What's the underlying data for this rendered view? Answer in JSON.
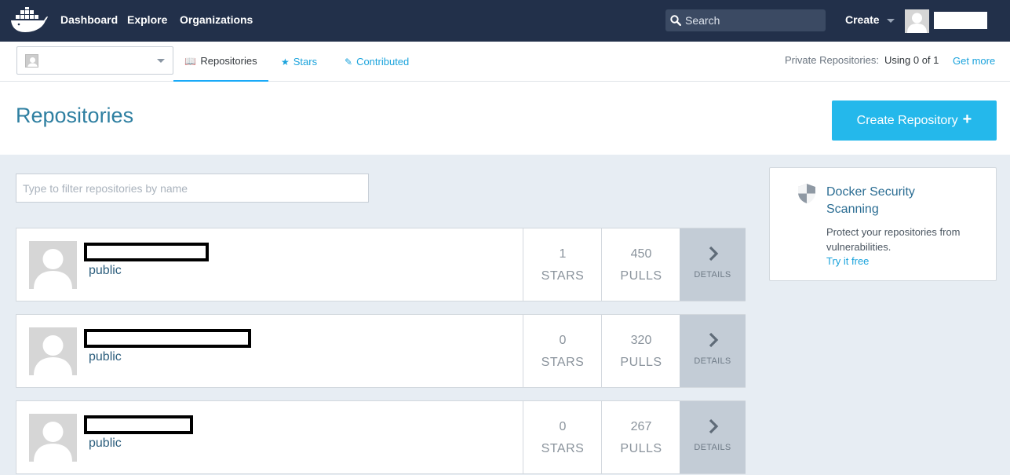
{
  "topnav": {
    "links": [
      "Dashboard",
      "Explore",
      "Organizations"
    ],
    "search_placeholder": "Search",
    "create_label": "Create",
    "icons": {
      "logo": "docker-whale-logo",
      "search": "search-icon",
      "avatar": "user-avatar"
    }
  },
  "subnav": {
    "tabs": [
      {
        "label": "Repositories",
        "icon": "book-icon",
        "active": true
      },
      {
        "label": "Stars",
        "icon": "star-icon",
        "active": false
      },
      {
        "label": "Contributed",
        "icon": "edit-icon",
        "active": false
      }
    ],
    "private_label": "Private Repositories:",
    "private_usage": "Using 0 of 1",
    "get_more": "Get more"
  },
  "header": {
    "title": "Repositories",
    "create_button": "Create Repository"
  },
  "filter": {
    "placeholder": "Type to filter repositories by name"
  },
  "repos": [
    {
      "visibility": "public",
      "stars": "1",
      "stars_label": "STARS",
      "pulls": "450",
      "pulls_label": "PULLS",
      "details": "DETAILS"
    },
    {
      "visibility": "public",
      "stars": "0",
      "stars_label": "STARS",
      "pulls": "320",
      "pulls_label": "PULLS",
      "details": "DETAILS"
    },
    {
      "visibility": "public",
      "stars": "0",
      "stars_label": "STARS",
      "pulls": "267",
      "pulls_label": "PULLS",
      "details": "DETAILS"
    }
  ],
  "security": {
    "title": "Docker Security Scanning",
    "description": "Protect your repositories from vulnerabilities.",
    "link": "Try it free",
    "icon": "shield-icon"
  },
  "colors": {
    "navbar": "#22304a",
    "accent": "#1ba3dc",
    "button": "#24b8eb",
    "title": "#2e7fa1",
    "background": "#e7edf3"
  }
}
